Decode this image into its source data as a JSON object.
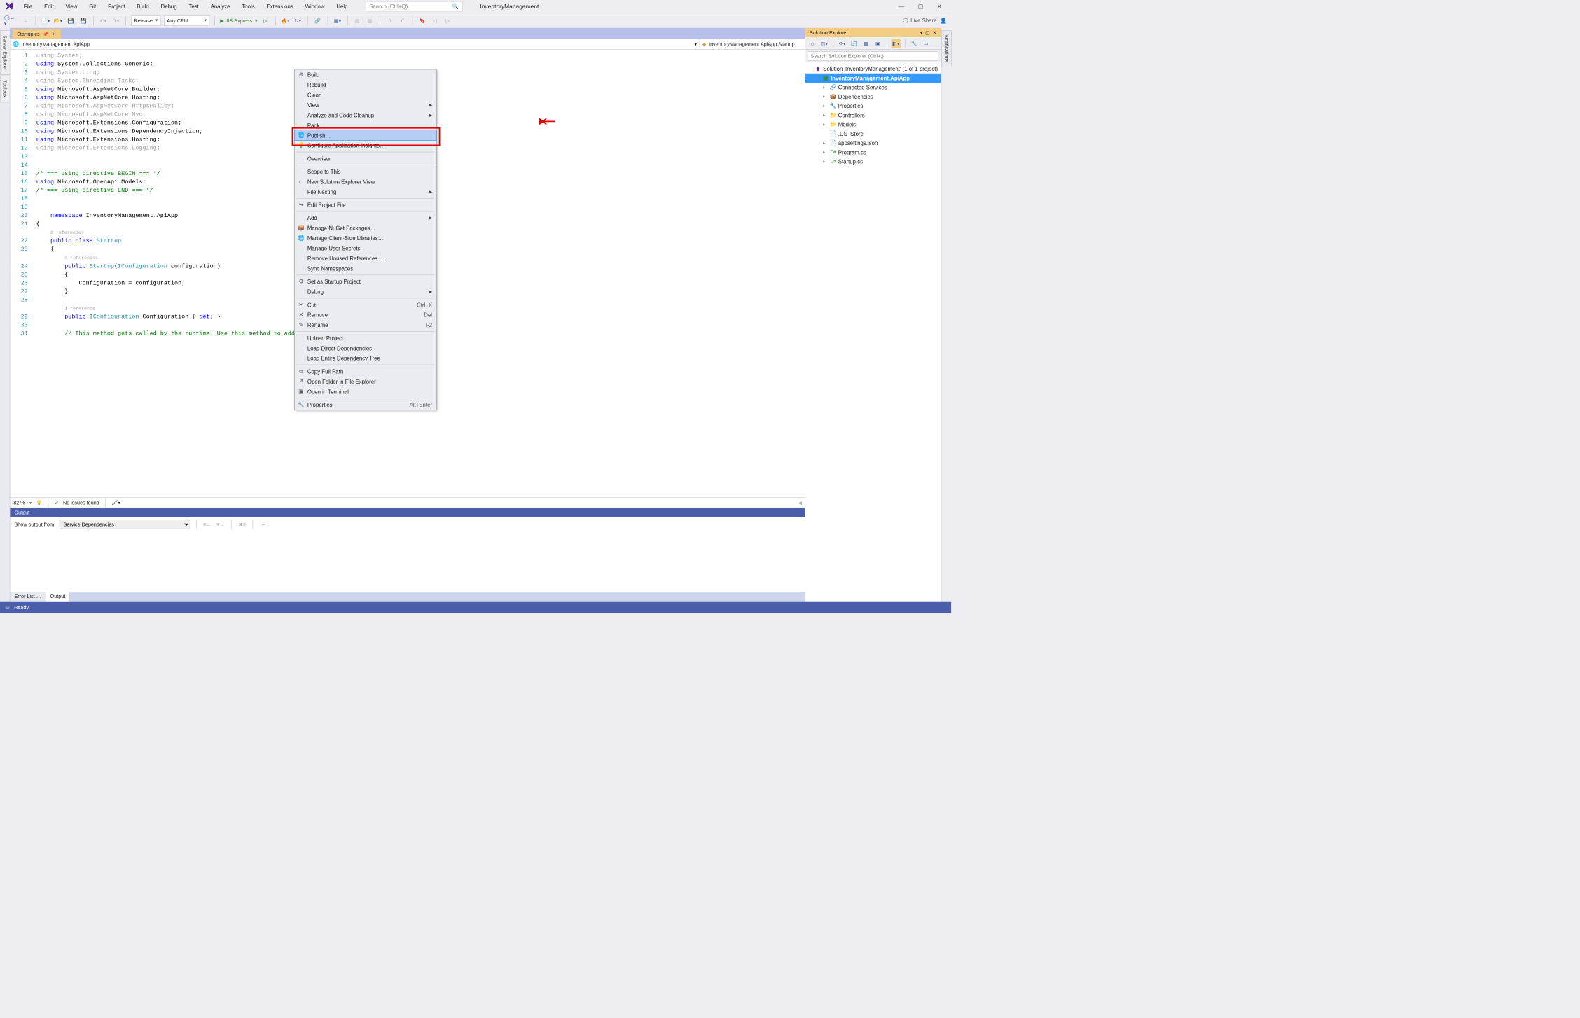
{
  "app": {
    "title": "InventoryManagement"
  },
  "menu": {
    "items": [
      "File",
      "Edit",
      "View",
      "Git",
      "Project",
      "Build",
      "Debug",
      "Test",
      "Analyze",
      "Tools",
      "Extensions",
      "Window",
      "Help"
    ]
  },
  "search": {
    "placeholder": "Search (Ctrl+Q)"
  },
  "toolbar": {
    "config": "Release",
    "platform": "Any CPU",
    "run": "IIS Express",
    "liveshare": "Live Share"
  },
  "left_tabs": [
    "Server Explorer",
    "Toolbox"
  ],
  "right_tabs": [
    "Notifications"
  ],
  "open_tab": {
    "name": "Startup.cs"
  },
  "nav": {
    "left": "InventoryManagement.ApiApp",
    "right": "InventoryManagement.ApiApp.Startup"
  },
  "code_lines": [
    {
      "n": 1,
      "html": "<span class='fade'>using</span> <span class='fade'>System;</span>"
    },
    {
      "n": 2,
      "html": "<span class='kw'>using</span> System.Collections.Generic;"
    },
    {
      "n": 3,
      "html": "<span class='fade'>using System.Linq;</span>"
    },
    {
      "n": 4,
      "html": "<span class='fade'>using System.Threading.Tasks;</span>"
    },
    {
      "n": 5,
      "html": "<span class='kw'>using</span> Microsoft.AspNetCore.Builder;"
    },
    {
      "n": 6,
      "html": "<span class='kw'>using</span> Microsoft.AspNetCore.Hosting;"
    },
    {
      "n": 7,
      "html": "<span class='fade'>using Microsoft.AspNetCore.HttpsPolicy;</span>"
    },
    {
      "n": 8,
      "html": "<span class='fade'>using Microsoft.AspNetCore.Mvc;</span>"
    },
    {
      "n": 9,
      "html": "<span class='kw'>using</span> Microsoft.Extensions.Configuration;"
    },
    {
      "n": 10,
      "html": "<span class='kw'>using</span> Microsoft.Extensions.DependencyInjection;"
    },
    {
      "n": 11,
      "html": "<span class='kw'>using</span> Microsoft.Extensions.Hosting;"
    },
    {
      "n": 12,
      "html": "<span class='fade'>using Microsoft.Extensions.Logging;</span>"
    },
    {
      "n": 13,
      "html": ""
    },
    {
      "n": 14,
      "html": ""
    },
    {
      "n": 15,
      "html": "<span class='cm'>/* === using directive BEGIN === */</span>"
    },
    {
      "n": 16,
      "html": "<span class='kw'>using</span> Microsoft.OpenApi.Models;"
    },
    {
      "n": 17,
      "html": "<span class='cm'>/* === using directive END === */</span>"
    },
    {
      "n": 18,
      "html": ""
    },
    {
      "n": 19,
      "html": ""
    },
    {
      "n": 20,
      "html": "    <span class='kw'>namespace</span> InventoryManagement.ApiApp"
    },
    {
      "n": 21,
      "html": "{"
    },
    {
      "n": "",
      "html": "    <span class='ref'>2 references</span>"
    },
    {
      "n": 22,
      "html": "    <span class='kw'>public class</span> <span class='ty'>Startup</span>"
    },
    {
      "n": 23,
      "html": "    {"
    },
    {
      "n": "",
      "html": "        <span class='ref'>0 references</span>"
    },
    {
      "n": 24,
      "html": "        <span class='kw'>public</span> <span class='ty'>Startup</span>(<span class='ty'>IConfiguration</span> configuration)"
    },
    {
      "n": 25,
      "html": "        {"
    },
    {
      "n": 26,
      "html": "            Configuration = configuration;"
    },
    {
      "n": 27,
      "html": "        }"
    },
    {
      "n": 28,
      "html": ""
    },
    {
      "n": "",
      "html": "        <span class='ref'>1 reference</span>"
    },
    {
      "n": 29,
      "html": "        <span class='kw'>public</span> <span class='ty'>IConfiguration</span> Configuration { <span class='kw'>get</span>; }"
    },
    {
      "n": 30,
      "html": ""
    },
    {
      "n": 31,
      "html": "        <span class='cm'>// This method gets called by the runtime. Use this method to add services to</span>"
    }
  ],
  "editor_foot": {
    "zoom": "82 %",
    "issues": "No issues found"
  },
  "output": {
    "title": "Output",
    "from_label": "Show output from:",
    "from_value": "Service Dependencies"
  },
  "bottom_tabs": {
    "errorlist": "Error List …",
    "output": "Output"
  },
  "status": {
    "text": "Ready"
  },
  "solution_explorer": {
    "title": "Solution Explorer",
    "search_placeholder": "Search Solution Explorer (Ctrl+;)",
    "root": "Solution 'InventoryManagement' (1 of 1 project)",
    "project": "InventoryManagement.ApiApp",
    "nodes": [
      {
        "label": "Connected Services",
        "icon": "🔗",
        "expandable": true
      },
      {
        "label": "Dependencies",
        "icon": "📦",
        "expandable": true
      },
      {
        "label": "Properties",
        "icon": "🔧",
        "expandable": true
      },
      {
        "label": "Controllers",
        "icon": "folder",
        "expandable": true
      },
      {
        "label": "Models",
        "icon": "folder",
        "expandable": true
      },
      {
        "label": ".DS_Store",
        "icon": "file",
        "expandable": false
      },
      {
        "label": "appsettings.json",
        "icon": "json",
        "expandable": true
      },
      {
        "label": "Program.cs",
        "icon": "cs",
        "expandable": true
      },
      {
        "label": "Startup.cs",
        "icon": "cs",
        "expandable": true
      }
    ]
  },
  "context_menu": [
    {
      "type": "item",
      "label": "Build",
      "icon": "⚙"
    },
    {
      "type": "item",
      "label": "Rebuild"
    },
    {
      "type": "item",
      "label": "Clean"
    },
    {
      "type": "item",
      "label": "View",
      "sub": true
    },
    {
      "type": "item",
      "label": "Analyze and Code Cleanup",
      "sub": true
    },
    {
      "type": "item",
      "label": "Pack"
    },
    {
      "type": "item",
      "label": "Publish…",
      "icon": "🌐",
      "highlight": true
    },
    {
      "type": "item",
      "label": "Configure Application Insights…",
      "icon": "💡"
    },
    {
      "type": "sep"
    },
    {
      "type": "item",
      "label": "Overview"
    },
    {
      "type": "sep"
    },
    {
      "type": "item",
      "label": "Scope to This"
    },
    {
      "type": "item",
      "label": "New Solution Explorer View",
      "icon": "▭"
    },
    {
      "type": "item",
      "label": "File Nesting",
      "sub": true
    },
    {
      "type": "sep"
    },
    {
      "type": "item",
      "label": "Edit Project File",
      "icon": "↪"
    },
    {
      "type": "sep"
    },
    {
      "type": "item",
      "label": "Add",
      "sub": true
    },
    {
      "type": "item",
      "label": "Manage NuGet Packages…",
      "icon": "📦"
    },
    {
      "type": "item",
      "label": "Manage Client-Side Libraries…",
      "icon": "🌐"
    },
    {
      "type": "item",
      "label": "Manage User Secrets"
    },
    {
      "type": "item",
      "label": "Remove Unused References…"
    },
    {
      "type": "item",
      "label": "Sync Namespaces"
    },
    {
      "type": "sep"
    },
    {
      "type": "item",
      "label": "Set as Startup Project",
      "icon": "⚙"
    },
    {
      "type": "item",
      "label": "Debug",
      "sub": true
    },
    {
      "type": "sep"
    },
    {
      "type": "item",
      "label": "Cut",
      "icon": "✂",
      "shortcut": "Ctrl+X"
    },
    {
      "type": "item",
      "label": "Remove",
      "icon": "✕",
      "shortcut": "Del"
    },
    {
      "type": "item",
      "label": "Rename",
      "icon": "✎",
      "shortcut": "F2"
    },
    {
      "type": "sep"
    },
    {
      "type": "item",
      "label": "Unload Project"
    },
    {
      "type": "item",
      "label": "Load Direct Dependencies"
    },
    {
      "type": "item",
      "label": "Load Entire Dependency Tree"
    },
    {
      "type": "sep"
    },
    {
      "type": "item",
      "label": "Copy Full Path",
      "icon": "⧉"
    },
    {
      "type": "item",
      "label": "Open Folder in File Explorer",
      "icon": "↗"
    },
    {
      "type": "item",
      "label": "Open in Terminal",
      "icon": "▣"
    },
    {
      "type": "sep"
    },
    {
      "type": "item",
      "label": "Properties",
      "icon": "🔧",
      "shortcut": "Alt+Enter"
    }
  ]
}
